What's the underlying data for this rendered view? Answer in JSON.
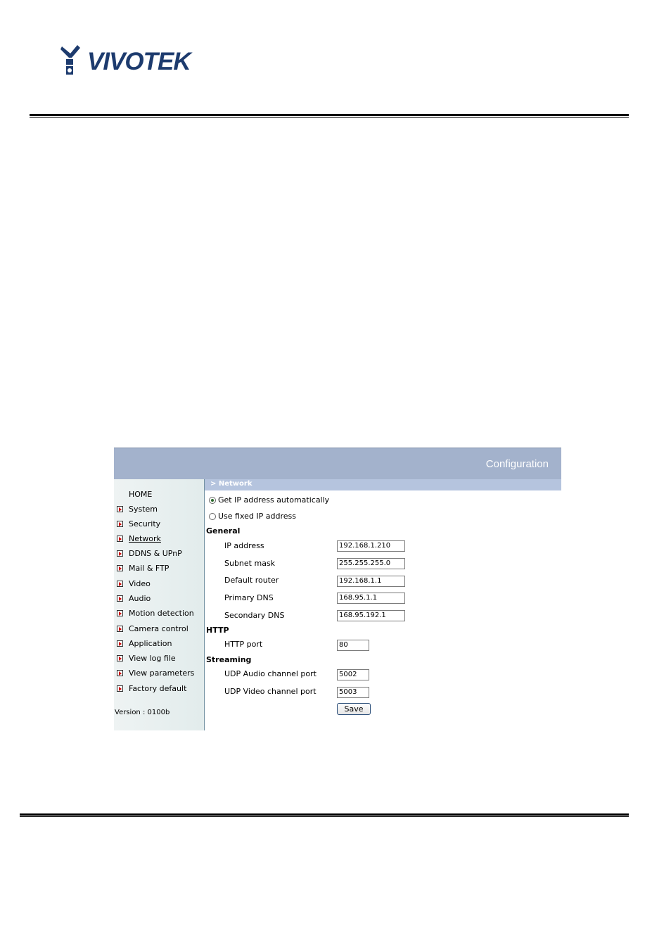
{
  "logo": {
    "text": "VIVOTEK"
  },
  "header": {
    "title": "Configuration"
  },
  "sidebar": {
    "items": [
      {
        "label": "HOME",
        "arrow": false
      },
      {
        "label": "System",
        "arrow": true
      },
      {
        "label": "Security",
        "arrow": true
      },
      {
        "label": "Network",
        "arrow": true,
        "active": true
      },
      {
        "label": "DDNS & UPnP",
        "arrow": true
      },
      {
        "label": "Mail & FTP",
        "arrow": true
      },
      {
        "label": "Video",
        "arrow": true
      },
      {
        "label": "Audio",
        "arrow": true
      },
      {
        "label": "Motion detection",
        "arrow": true
      },
      {
        "label": "Camera control",
        "arrow": true
      },
      {
        "label": "Application",
        "arrow": true
      },
      {
        "label": "View log file",
        "arrow": true
      },
      {
        "label": "View parameters",
        "arrow": true
      },
      {
        "label": "Factory default",
        "arrow": true
      }
    ],
    "version": "Version : 0100b"
  },
  "section": {
    "title": "> Network"
  },
  "network": {
    "auto_ip_label": "Get IP address automatically",
    "fixed_ip_label": "Use fixed IP address",
    "general": {
      "title": "General",
      "ip_label": "IP address",
      "ip_value": "192.168.1.210",
      "subnet_label": "Subnet mask",
      "subnet_value": "255.255.255.0",
      "router_label": "Default router",
      "router_value": "192.168.1.1",
      "dns1_label": "Primary DNS",
      "dns1_value": "168.95.1.1",
      "dns2_label": "Secondary DNS",
      "dns2_value": "168.95.192.1"
    },
    "http": {
      "title": "HTTP",
      "port_label": "HTTP port",
      "port_value": "80"
    },
    "streaming": {
      "title": "Streaming",
      "audio_label": "UDP Audio channel port",
      "audio_value": "5002",
      "video_label": "UDP Video channel port",
      "video_value": "5003"
    },
    "save_label": "Save"
  },
  "colors": {
    "header": "#a3b2cc",
    "section_bar": "#b5c4de",
    "logo": "#1d3b6e"
  }
}
